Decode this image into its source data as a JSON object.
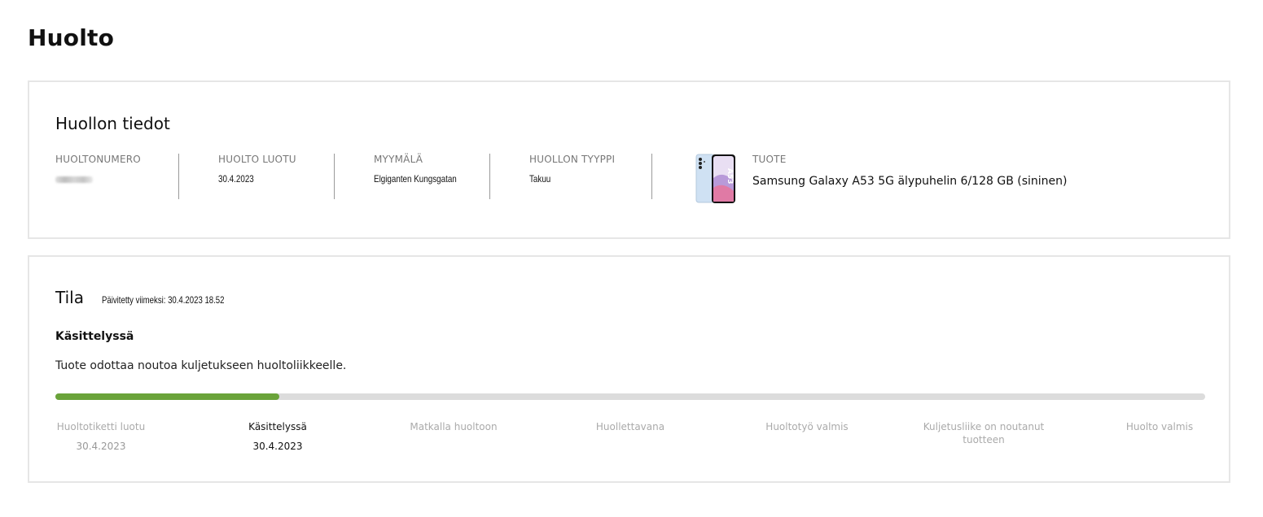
{
  "page": {
    "title": "Huolto"
  },
  "info": {
    "title": "Huollon tiedot",
    "columns": [
      {
        "label": "HUOLTONUMERO",
        "value": ""
      },
      {
        "label": "HUOLTO LUOTU",
        "value": "30.4.2023"
      },
      {
        "label": "MYYMÄLÄ",
        "value": "Elgiganten Kungsgatan"
      },
      {
        "label": "HUOLLON TYYPPI",
        "value": "Takuu"
      }
    ],
    "product": {
      "label": "TUOTE",
      "name": "Samsung Galaxy A53 5G älypuhelin 6/128 GB (sininen)",
      "thumb_text": "A53"
    }
  },
  "status": {
    "title": "Tila",
    "updated": "Päivitetty viimeksi: 30.4.2023 18.52",
    "state_title": "Käsittelyssä",
    "state_description": "Tuote odottaa noutoa kuljetukseen huoltoliikkeelle.",
    "progress": 0.195,
    "colors": {
      "progress_fill": "#6aa33a",
      "progress_track": "#dcdcdc"
    },
    "steps": [
      {
        "label": "Huoltotiketti luotu",
        "date": "30.4.2023",
        "active": false
      },
      {
        "label": "Käsittelyssä",
        "date": "30.4.2023",
        "active": true
      },
      {
        "label": "Matkalla huoltoon",
        "date": "",
        "active": false
      },
      {
        "label": "Huollettavana",
        "date": "",
        "active": false
      },
      {
        "label": "Huoltotyö valmis",
        "date": "",
        "active": false
      },
      {
        "label": "Kuljetusliike on noutanut tuotteen",
        "date": "",
        "active": false
      },
      {
        "label": "Huolto valmis",
        "date": "",
        "active": false
      }
    ]
  }
}
